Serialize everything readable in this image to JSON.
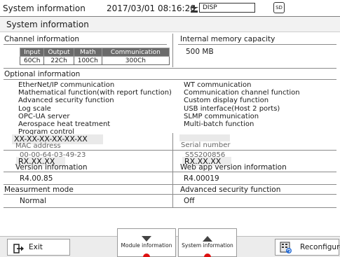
{
  "header": {
    "title": "System  information",
    "datetime": "2017/03/01  08:16:20",
    "disp_label": "DISP",
    "sd_label": "SD"
  },
  "page_title": "System  information",
  "channel_info": {
    "label": "Channel information",
    "columns": [
      "Input",
      "Output",
      "Math",
      "Communication"
    ],
    "values": [
      "60Ch",
      "22Ch",
      "100Ch",
      "300Ch"
    ]
  },
  "internal_memory": {
    "label": "Internal memory capacity",
    "value": "500  MB"
  },
  "optional_info": {
    "label": "Optional information",
    "left": [
      "EtherNet/IP  communication",
      "Mathematical  function(with  report  function)",
      "Advanced  security  function",
      "Log  scale",
      "OPC-UA  server",
      "Aerospace  heat  treatment",
      "Program  control"
    ],
    "right": [
      "WT  communication",
      "Communication  channel  function",
      "Custom  display  function",
      "USB  interface(Host  2  ports)",
      "SLMP  communication",
      "Multi-batch  function"
    ]
  },
  "mac_address": {
    "label": "MAC  address",
    "masked": "XX-XX-XX-XX-XX-XX",
    "partial_value": "00-00-64-03-49-23"
  },
  "serial_number": {
    "label": "Serial  number",
    "partial_value": "S5S200856",
    "masked": "RX.XX.XX"
  },
  "version": {
    "label": "Version  information",
    "masked": "RX.XX.XX",
    "value": "R4.00.85"
  },
  "web_app_version": {
    "label": "Web  app  version  information",
    "value": "R4.00019"
  },
  "measurement_mode": {
    "label": "Measurment mode",
    "value": "Normal"
  },
  "advanced_security": {
    "label": "Advanced security function",
    "value": "Off"
  },
  "footer": {
    "exit": "Exit",
    "module_info": "Module  information",
    "system_info": "System  information",
    "reconfigure": "Reconfigure"
  },
  "colors": {
    "table_header": "#6b6b6b",
    "indicator_red": "#dd1111"
  }
}
